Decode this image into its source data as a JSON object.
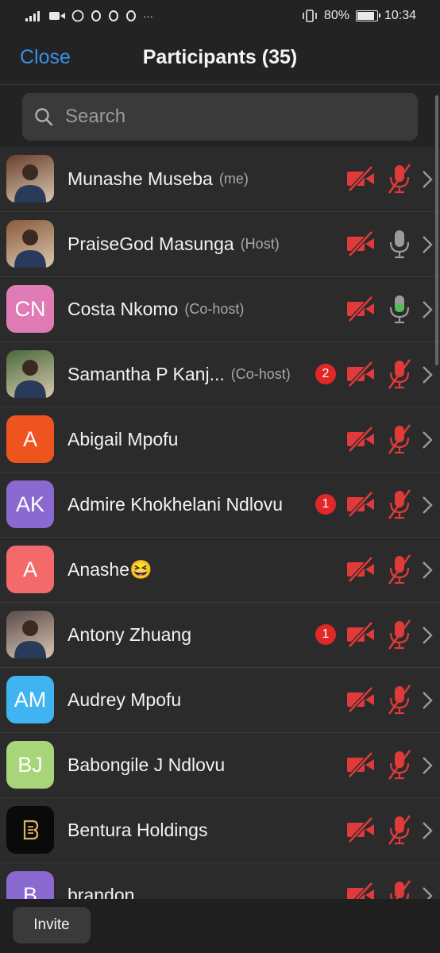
{
  "status_bar": {
    "left_icons": [
      "signal-icon",
      "video-camera-icon",
      "whatsapp-icon",
      "circle-o-icon",
      "circle-o-icon",
      "circle-o-icon"
    ],
    "more": "···",
    "battery_percent": "80%",
    "time": "10:34"
  },
  "header": {
    "close_label": "Close",
    "title": "Participants (35)"
  },
  "search": {
    "placeholder": "Search"
  },
  "participants": [
    {
      "name": "Munashe Museba",
      "role": "(me)",
      "avatar_type": "photo",
      "avatar_color": "#6b3e2e",
      "initials": "",
      "badge": "",
      "video": "off",
      "mic": "muted"
    },
    {
      "name": "PraiseGod Masunga",
      "role": "(Host)",
      "avatar_type": "photo",
      "avatar_color": "#8a5a3a",
      "initials": "",
      "badge": "",
      "video": "off",
      "mic": "on-idle"
    },
    {
      "name": "Costa Nkomo",
      "role": "(Co-host)",
      "avatar_type": "initials",
      "avatar_color": "#e07bb6",
      "initials": "CN",
      "badge": "",
      "video": "off",
      "mic": "speaking"
    },
    {
      "name": "Samantha P Kanj...",
      "role": "(Co-host)",
      "avatar_type": "photo",
      "avatar_color": "#4a6a3a",
      "initials": "",
      "badge": "2",
      "video": "off",
      "mic": "muted"
    },
    {
      "name": "Abigail Mpofu",
      "role": "",
      "avatar_type": "initials",
      "avatar_color": "#f0541e",
      "initials": "A",
      "badge": "",
      "video": "off",
      "mic": "muted"
    },
    {
      "name": "Admire Khokhelani Ndlovu",
      "role": "",
      "avatar_type": "initials",
      "avatar_color": "#8a6ad0",
      "initials": "AK",
      "badge": "1",
      "video": "off",
      "mic": "muted"
    },
    {
      "name": "Anashe😆",
      "role": "",
      "avatar_type": "initials",
      "avatar_color": "#f46a6a",
      "initials": "A",
      "badge": "",
      "video": "off",
      "mic": "muted"
    },
    {
      "name": "Antony Zhuang",
      "role": "",
      "avatar_type": "photo",
      "avatar_color": "#5a4a4a",
      "initials": "",
      "badge": "1",
      "video": "off",
      "mic": "muted"
    },
    {
      "name": "Audrey Mpofu",
      "role": "",
      "avatar_type": "initials",
      "avatar_color": "#3fb4f0",
      "initials": "AM",
      "badge": "",
      "video": "off",
      "mic": "muted"
    },
    {
      "name": "Babongile J Ndlovu",
      "role": "",
      "avatar_type": "initials",
      "avatar_color": "#a8d47a",
      "initials": "BJ",
      "badge": "",
      "video": "off",
      "mic": "muted"
    },
    {
      "name": "Bentura Holdings",
      "role": "",
      "avatar_type": "logo",
      "avatar_color": "#0a0a0a",
      "initials": "",
      "badge": "",
      "video": "off",
      "mic": "muted"
    },
    {
      "name": "brandon",
      "role": "",
      "avatar_type": "initials",
      "avatar_color": "#8a6ad0",
      "initials": "B",
      "badge": "",
      "video": "off",
      "mic": "muted"
    }
  ],
  "footer": {
    "invite_label": "Invite"
  },
  "colors": {
    "accent": "#3b8fe6",
    "muted_red": "#e03a3a",
    "speaking_green": "#4cc24c",
    "badge_red": "#e02828"
  }
}
